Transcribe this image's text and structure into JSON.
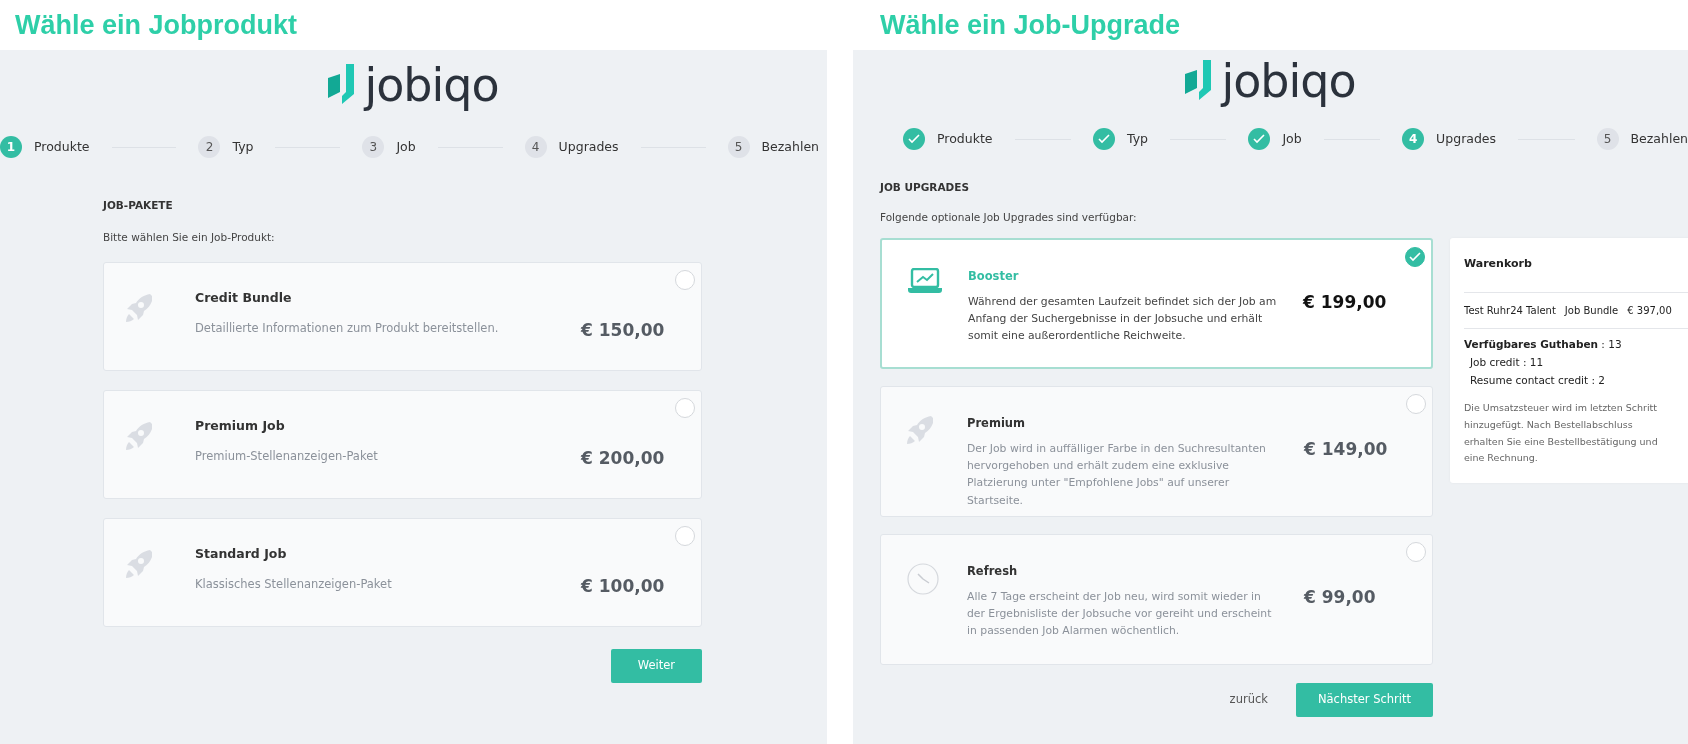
{
  "panels": [
    {
      "title": "Wähle ein Jobprodukt",
      "logo": "jobiqo",
      "steps": [
        {
          "number": "1",
          "label": "Produkte",
          "done": false,
          "selected": true
        },
        {
          "number": "2",
          "label": "Typ",
          "done": false,
          "selected": false
        },
        {
          "number": "3",
          "label": "Job",
          "done": false,
          "selected": false
        },
        {
          "number": "4",
          "label": "Upgrades",
          "done": false,
          "selected": false
        },
        {
          "number": "5",
          "label": "Bezahlen",
          "done": false,
          "selected": false
        }
      ],
      "heading": "JOB-PAKETE",
      "subtitle": "Bitte wählen Sie ein Job-Produkt:",
      "cards": [
        {
          "kind": "rocket",
          "title": "Credit Bundle",
          "description": "Detaillierte Informationen zum Produkt bereitstellen.",
          "price": "€ 150,00",
          "selected": false
        },
        {
          "kind": "rocket",
          "title": "Premium Job",
          "description": "Premium-Stellenanzeigen-Paket",
          "price": "€ 200,00",
          "selected": false
        },
        {
          "kind": "rocket",
          "title": "Standard Job",
          "description": "Klassisches Stellenanzeigen-Paket",
          "price": "€ 100,00",
          "selected": false
        }
      ],
      "buttons": [
        {
          "kind": "primary",
          "label": "Weiter"
        }
      ]
    },
    {
      "title": "Wähle ein Job-Upgrade",
      "logo": "jobiqo",
      "steps": [
        {
          "label": "Produkte",
          "done": true,
          "selected": false
        },
        {
          "label": "Typ",
          "done": true,
          "selected": false
        },
        {
          "label": "Job",
          "done": true,
          "selected": false
        },
        {
          "number": "4",
          "label": "Upgrades",
          "done": false,
          "selected": true
        },
        {
          "number": "5",
          "label": "Bezahlen",
          "done": false,
          "selected": false
        }
      ],
      "heading": "JOB UPGRADES",
      "subtitle": "Folgende optionale Job Upgrades sind verfügbar:",
      "cards": [
        {
          "kind": "laptop",
          "title": "Booster",
          "description": "Während der gesamten Laufzeit befindet sich der Job am Anfang der Suchergebnisse in der Jobsuche und erhält somit eine außerordentliche Reichweite.",
          "price": "€ 199,00",
          "selected": true
        },
        {
          "kind": "rocket",
          "title": "Premium",
          "description": "Der Job wird in auffälliger Farbe in den Suchresultanten hervorgehoben und erhält zudem eine exklusive Platzierung unter \"Empfohlene Jobs\" auf unserer Startseite.",
          "price": "€ 149,00",
          "selected": false
        },
        {
          "kind": "clock",
          "title": "Refresh",
          "description": "Alle 7 Tage erscheint der Job neu, wird somit wieder in der Ergebnisliste der Jobsuche vor gereiht und erscheint in passenden Job Alarmen wöchentlich.",
          "price": "€ 99,00",
          "selected": false
        }
      ],
      "cart": {
        "title": "Warenkorb",
        "items": [
          {
            "name": "Test Ruhr24 Talent",
            "type": "Job Bundle",
            "price": "€ 397,00"
          }
        ],
        "credit_label": "Verfügbares Guthaben",
        "credit_value": ": 13",
        "credits": [
          "Job credit : 11",
          "Resume contact credit : 2"
        ],
        "note": "Die Umsatzsteuer wird im letzten Schritt hinzugefügt. Nach Bestellabschluss erhalten Sie eine Bestellbestätigung und eine Rechnung."
      },
      "buttons": [
        {
          "kind": "link",
          "label": "zurück"
        },
        {
          "kind": "primary",
          "label": "Nächster Schritt"
        }
      ]
    }
  ]
}
